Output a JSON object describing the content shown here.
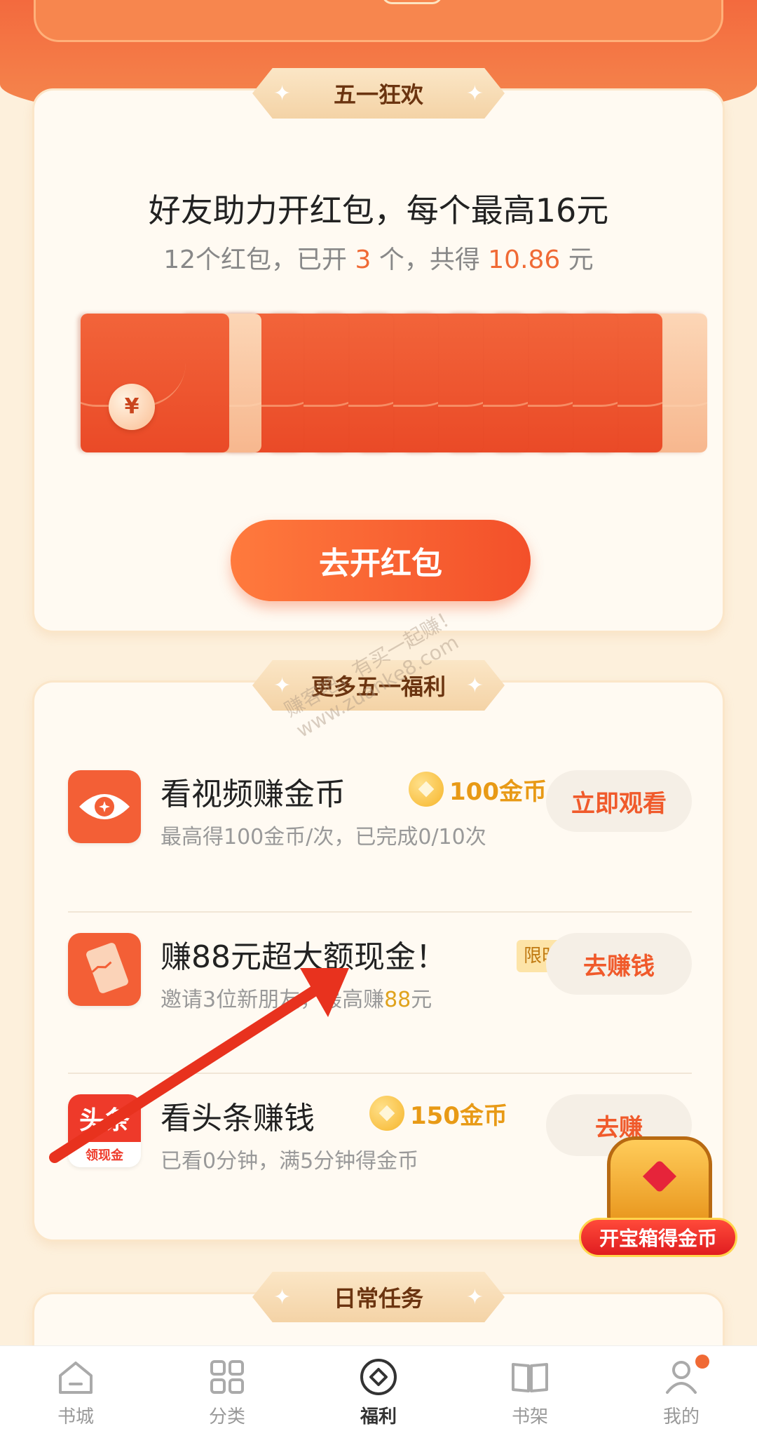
{
  "promo": {
    "ribbon": "五一狂欢",
    "headline": "好友助力开红包，每个最高16元",
    "sub_prefix": "12个红包，已开 ",
    "opened_count": "3",
    "sub_mid": " 个，共得 ",
    "total_amount": "10.86",
    "sub_suffix": " 元",
    "coin_symbol": "¥",
    "total_envelopes": 12,
    "opened_envelopes": 3,
    "open_button": "去开红包"
  },
  "more": {
    "ribbon": "更多五一福利",
    "tasks": [
      {
        "title": "看视频赚金币",
        "coin_text": "100金币",
        "desc": "最高得100金币/次，已完成0/10次",
        "button": "立即观看"
      },
      {
        "title": "赚88元超大额现金！",
        "tag": "限时",
        "desc_prefix": "邀请3位新朋友，最高赚",
        "desc_amount": "88",
        "desc_suffix": "元",
        "button": "去赚钱"
      },
      {
        "title": "看头条赚钱",
        "coin_text": "150金币",
        "desc": "已看0分钟，满5分钟得金币",
        "button": "去赚",
        "icon_top": "头条",
        "icon_bottom": "领现金"
      }
    ]
  },
  "daily": {
    "ribbon": "日常任务"
  },
  "watermark": {
    "line1": "赚客吧，有买一起赚！",
    "line2": "www.zuanke8.com"
  },
  "chest": {
    "label": "开宝箱得金币"
  },
  "nav": {
    "items": [
      {
        "label": "书城"
      },
      {
        "label": "分类"
      },
      {
        "label": "福利"
      },
      {
        "label": "书架"
      },
      {
        "label": "我的"
      }
    ]
  },
  "colors": {
    "accent": "#f05a2b",
    "gold": "#e89a16",
    "background": "#fdf0dc"
  }
}
